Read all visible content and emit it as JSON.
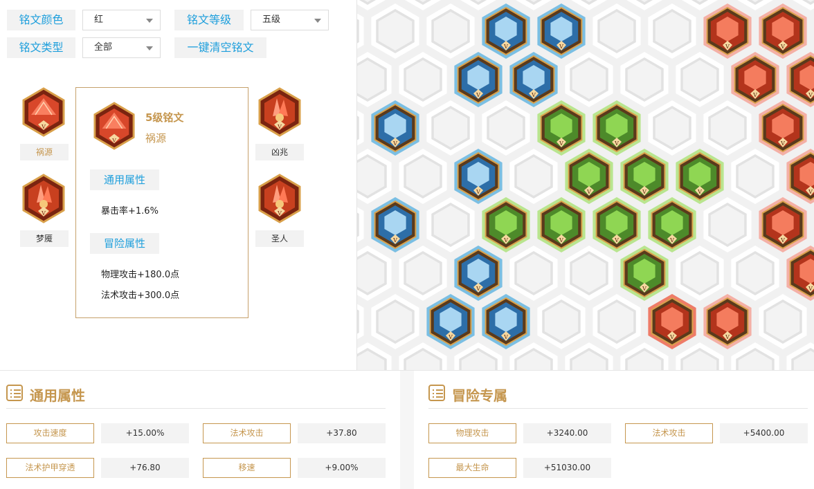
{
  "filters": {
    "color_label": "铭文颜色",
    "color_value": "红",
    "level_label": "铭文等级",
    "level_value": "五级",
    "type_label": "铭文类型",
    "type_value": "全部",
    "clear_label": "一键清空铭文"
  },
  "inscriptions": [
    {
      "name": "祸源",
      "icon": "red-inscription-fan-icon"
    },
    {
      "name": "凶兆",
      "icon": "red-inscription-crystal-icon"
    },
    {
      "name": "梦魇",
      "icon": "red-inscription-crystal-icon"
    },
    {
      "name": "圣人",
      "icon": "red-inscription-crystal-icon"
    }
  ],
  "detail": {
    "level": "5级铭文",
    "name": "祸源",
    "general_heading": "通用属性",
    "general_lines": [
      "暴击率+1.6%"
    ],
    "adventure_heading": "冒险属性",
    "adventure_lines": [
      "物理攻击+180.0点",
      "法术攻击+300.0点"
    ]
  },
  "board": {
    "colors": {
      "blue": "#7bbfe3",
      "blue_inner": "#2d6ea8",
      "green": "#b9e58f",
      "green_inner": "#4d8a2a",
      "red": "#f4b0a6",
      "red_active": "#ee7c68",
      "red_inner": "#b3341c",
      "empty": "#e2e2e2"
    }
  },
  "bottom": {
    "general": {
      "title": "通用属性",
      "stats": [
        {
          "label": "攻击速度",
          "value": "+15.00%"
        },
        {
          "label": "法术攻击",
          "value": "+37.80"
        },
        {
          "label": "法术护甲穿透",
          "value": "+76.80"
        },
        {
          "label": "移速",
          "value": "+9.00%"
        }
      ]
    },
    "adventure": {
      "title": "冒险专属",
      "stats": [
        {
          "label": "物理攻击",
          "value": "+3240.00"
        },
        {
          "label": "法术攻击",
          "value": "+5400.00"
        },
        {
          "label": "最大生命",
          "value": "+51030.00"
        }
      ]
    }
  }
}
